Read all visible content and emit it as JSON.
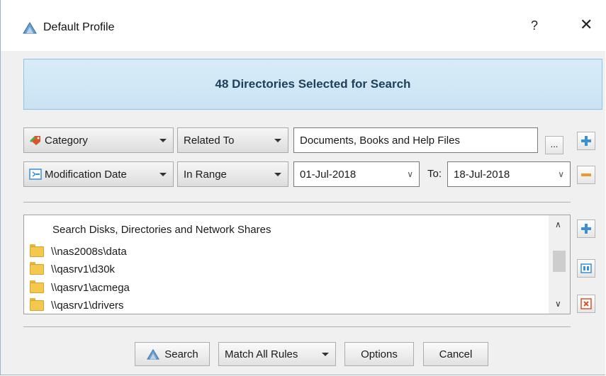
{
  "window": {
    "title": "Default Profile",
    "help_label": "?",
    "close_label": "✕"
  },
  "banner": {
    "text": "48 Directories Selected for Search"
  },
  "rules": [
    {
      "field": "Category",
      "operator": "Related To",
      "value": "Documents, Books and Help Files",
      "browse_label": "...",
      "action": "add"
    },
    {
      "field": "Modification Date",
      "operator": "In Range",
      "from_date": "01-Jul-2018",
      "to_label": "To:",
      "to_date": "18-Jul-2018",
      "action": "remove"
    }
  ],
  "directories": {
    "header": "Search Disks, Directories and Network Shares",
    "items": [
      "\\\\nas2008s\\data",
      "\\\\qasrv1\\d30k",
      "\\\\qasrv1\\acmega",
      "\\\\qasrv1\\drivers"
    ]
  },
  "buttons": {
    "search": "Search",
    "match_mode": "Match All Rules",
    "options": "Options",
    "cancel": "Cancel"
  },
  "colors": {
    "banner_bg": "#c9e3f4",
    "banner_border": "#8ec3e6",
    "add_icon": "#3a8fd6",
    "remove_icon": "#e89a2c",
    "delete_icon": "#d9532c",
    "folder": "#f3c84d"
  }
}
